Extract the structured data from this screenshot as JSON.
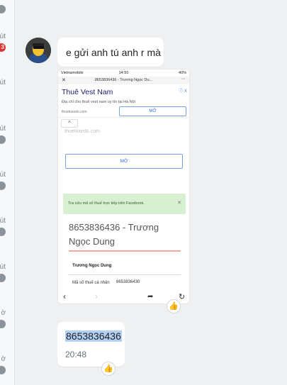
{
  "sidebar": {
    "items": [
      {
        "time": "",
        "badge": ""
      },
      {
        "time": "út",
        "badge": "3",
        "badge_color": "#e03232"
      },
      {
        "time": "út",
        "badge": ""
      },
      {
        "time": "út",
        "badge": ""
      },
      {
        "time": "út",
        "badge": ""
      },
      {
        "time": "út",
        "badge": ""
      },
      {
        "time": "út",
        "badge": ""
      },
      {
        "time": "ờ",
        "badge": ""
      },
      {
        "time": "ờ",
        "badge": ""
      }
    ]
  },
  "messages": {
    "text_message": "e gửi anh tú anh r mà",
    "photo": {
      "status_carrier": "Vietnamobile",
      "status_time": "14:50",
      "status_battery": "40%",
      "tab_title": "8653836436 - Trương Ngọc Du...",
      "ad_title": "Thuê Vest Nam",
      "ad_info": "ⓘ X",
      "ad_desc": "Địa chỉ cho thuê vest nam uy tín tại Hà Nội",
      "ad_url": "thuetuxedo.com",
      "ad_button": "MỞ",
      "site": "thuetuxedo.com",
      "open_button": "MỞ",
      "notice_text": "Tra cứu mã số thuế trực tiếp trên Facebook.",
      "company_title": "8653836436 - Trương Ngọc Dung",
      "table_name": "Trương Ngọc Dung",
      "field_label": "Mã số thuế cá nhân",
      "field_value": "8653836430"
    },
    "number_message": "8653836436",
    "number_time": "20:48"
  },
  "colors": {
    "selection_highlight": "#b3cff1",
    "badge_red": "#e03232",
    "link_blue": "#3a6fd6"
  }
}
